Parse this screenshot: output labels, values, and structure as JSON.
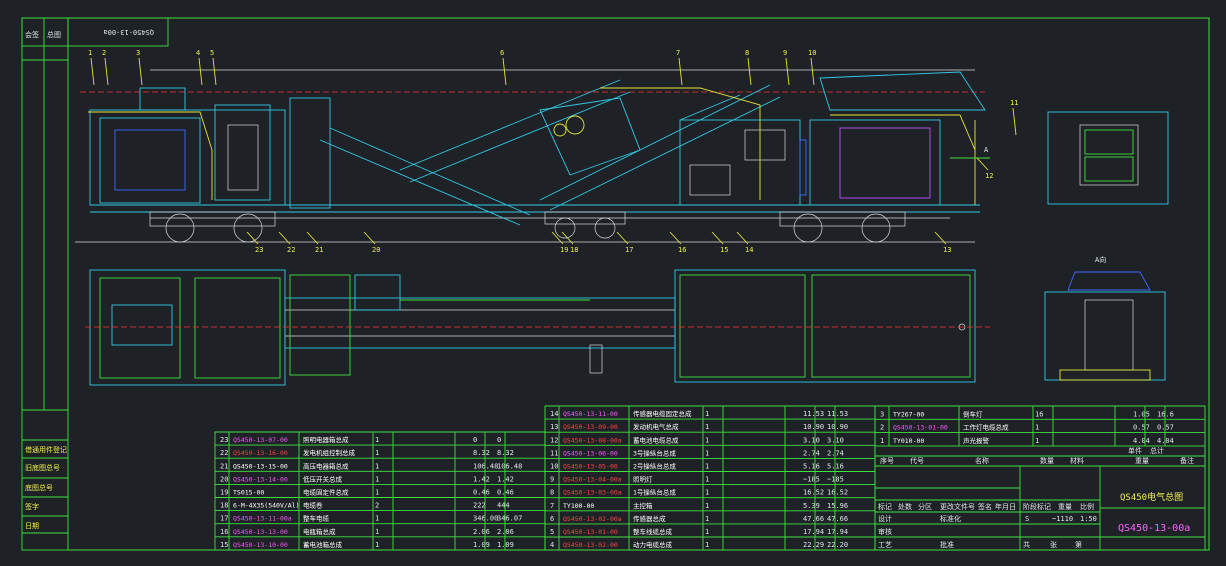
{
  "drawing": {
    "title": "QS450电气总图",
    "drawing_no": "QS450-13-00a",
    "stamp_no": "QS450-13-00a",
    "scale": "1:50",
    "weight": "~1110",
    "stage_mark": "S",
    "view_a_label": "A向",
    "arrow_a_label": "A"
  },
  "side_labels": {
    "corner_top_a": "会签",
    "corner_top_b": "总图",
    "side_a": "借通用件登记",
    "side_b": "旧底图总号",
    "side_c": "底图总号",
    "side_d": "签字",
    "side_e": "日期"
  },
  "callouts": [
    "1",
    "2",
    "3",
    "4",
    "5",
    "6",
    "7",
    "8",
    "9",
    "10",
    "11",
    "12",
    "13",
    "14",
    "15",
    "16",
    "17",
    "18",
    "19",
    "20",
    "21",
    "22",
    "23"
  ],
  "bom_left": [
    {
      "no": "23",
      "code": "QS450-13-07-00",
      "name": "照明电器箱总成",
      "qty": "1",
      "w1": "0",
      "w2": "0",
      "style": "m"
    },
    {
      "no": "22",
      "code": "QS450-13-16-00",
      "name": "发电机组控制总成",
      "qty": "1",
      "w1": "8.32",
      "w2": "8.32",
      "style": "r"
    },
    {
      "no": "21",
      "code": "QS450-13-15-00",
      "name": "高压电器箱总成",
      "qty": "1",
      "w1": "106.48",
      "w2": "106.48",
      "style": "w"
    },
    {
      "no": "20",
      "code": "QS450-13-14-00",
      "name": "低压开关总成",
      "qty": "1",
      "w1": "1.42",
      "w2": "1.42",
      "style": "m"
    },
    {
      "no": "19",
      "code": "TS015-00",
      "name": "电缆固定件总成",
      "qty": "1",
      "w1": "0.46",
      "w2": "0.46",
      "style": "w"
    },
    {
      "no": "18",
      "code": "6-M-4X35(540V/Al)",
      "name": "电缆卷",
      "qty": "2",
      "w1": "222",
      "w2": "444",
      "style": "w"
    },
    {
      "no": "17",
      "code": "QS450-13-11-00a",
      "name": "整车电缆",
      "qty": "1",
      "w1": "346.00",
      "w2": "346.07",
      "style": "m"
    },
    {
      "no": "16",
      "code": "QS450-13-13-00",
      "name": "电瓶箱总成",
      "qty": "1",
      "w1": "2.06",
      "w2": "2.06",
      "style": "m"
    },
    {
      "no": "15",
      "code": "QS450-13-10-00",
      "name": "蓄电池箱总成",
      "qty": "1",
      "w1": "1.09",
      "w2": "1.09",
      "style": "m"
    }
  ],
  "bom_mid": [
    {
      "no": "14",
      "code": "QS450-13-11-00",
      "name": "传感器电缆固定总成",
      "qty": "1",
      "w1": "11.53",
      "w2": "11.53",
      "style": "m"
    },
    {
      "no": "13",
      "code": "QS450-13-09-00",
      "name": "发动机电气总成",
      "qty": "1",
      "w1": "10.90",
      "w2": "10.90",
      "style": "r"
    },
    {
      "no": "12",
      "code": "QS450-13-08-00a",
      "name": "蓄电池电缆总成",
      "qty": "1",
      "w1": "3.10",
      "w2": "3.10",
      "style": "r"
    },
    {
      "no": "11",
      "code": "QS450-13-06-00",
      "name": "3号操纵台总成",
      "qty": "1",
      "w1": "2.74",
      "w2": "2.74",
      "style": "m"
    },
    {
      "no": "10",
      "code": "QS450-13-05-00",
      "name": "2号操纵台总成",
      "qty": "1",
      "w1": "5.16",
      "w2": "5.16",
      "style": "r"
    },
    {
      "no": "9",
      "code": "QS450-13-04-00a",
      "name": "照明灯",
      "qty": "1",
      "w1": "~185",
      "w2": "~185",
      "style": "r"
    },
    {
      "no": "8",
      "code": "QS450-13-03-00a",
      "name": "1号操纵台总成",
      "qty": "1",
      "w1": "16.52",
      "w2": "16.52",
      "style": "r"
    },
    {
      "no": "7",
      "code": "TY100-00",
      "name": "主控箱",
      "qty": "1",
      "w1": "5.39",
      "w2": "15.96",
      "style": "w"
    },
    {
      "no": "6",
      "code": "QS450-13-02-00a",
      "name": "传感器总成",
      "qty": "1",
      "w1": "47.66",
      "w2": "47.66",
      "style": "r"
    },
    {
      "no": "5",
      "code": "QS450-13-01-00",
      "name": "整车线缆总成",
      "qty": "1",
      "w1": "17.94",
      "w2": "17.94",
      "style": "r"
    },
    {
      "no": "4",
      "code": "QS450-13-02-00",
      "name": "动力电缆总成",
      "qty": "1",
      "w1": "22.29",
      "w2": "22.20",
      "style": "r"
    }
  ],
  "bom_right": [
    {
      "no": "3",
      "code": "TY267-00",
      "name": "倒车灯",
      "qty": "16",
      "w1": "1.05",
      "w2": "16.6",
      "style": "w"
    },
    {
      "no": "2",
      "code": "QS450-13-01-00",
      "name": "工作灯电缆总成",
      "qty": "1",
      "w1": "0.57",
      "w2": "0.57",
      "style": "m"
    },
    {
      "no": "1",
      "code": "TY010-00",
      "name": "声光报警",
      "qty": "1",
      "w1": "4.04",
      "w2": "4.04",
      "style": "w"
    }
  ],
  "bom_header": {
    "no": "序号",
    "code": "代号",
    "name": "名称",
    "qty": "数量",
    "material": "材料",
    "w_single": "单件",
    "w_total": "总计",
    "weight": "重量",
    "note": "备注"
  },
  "title_block": {
    "r1": [
      "标记",
      "处数",
      "分区",
      "更改文件号",
      "签名",
      "年月日"
    ],
    "r2a": "设计",
    "r2b": "标准化",
    "r3a": "审核",
    "r4a": "工艺",
    "r4b": "批准",
    "stage_label": "阶段标记",
    "weight_label": "重量",
    "scale_label": "比例",
    "sheet_total": "共",
    "sheet": "张",
    "sheet_of": "第"
  }
}
